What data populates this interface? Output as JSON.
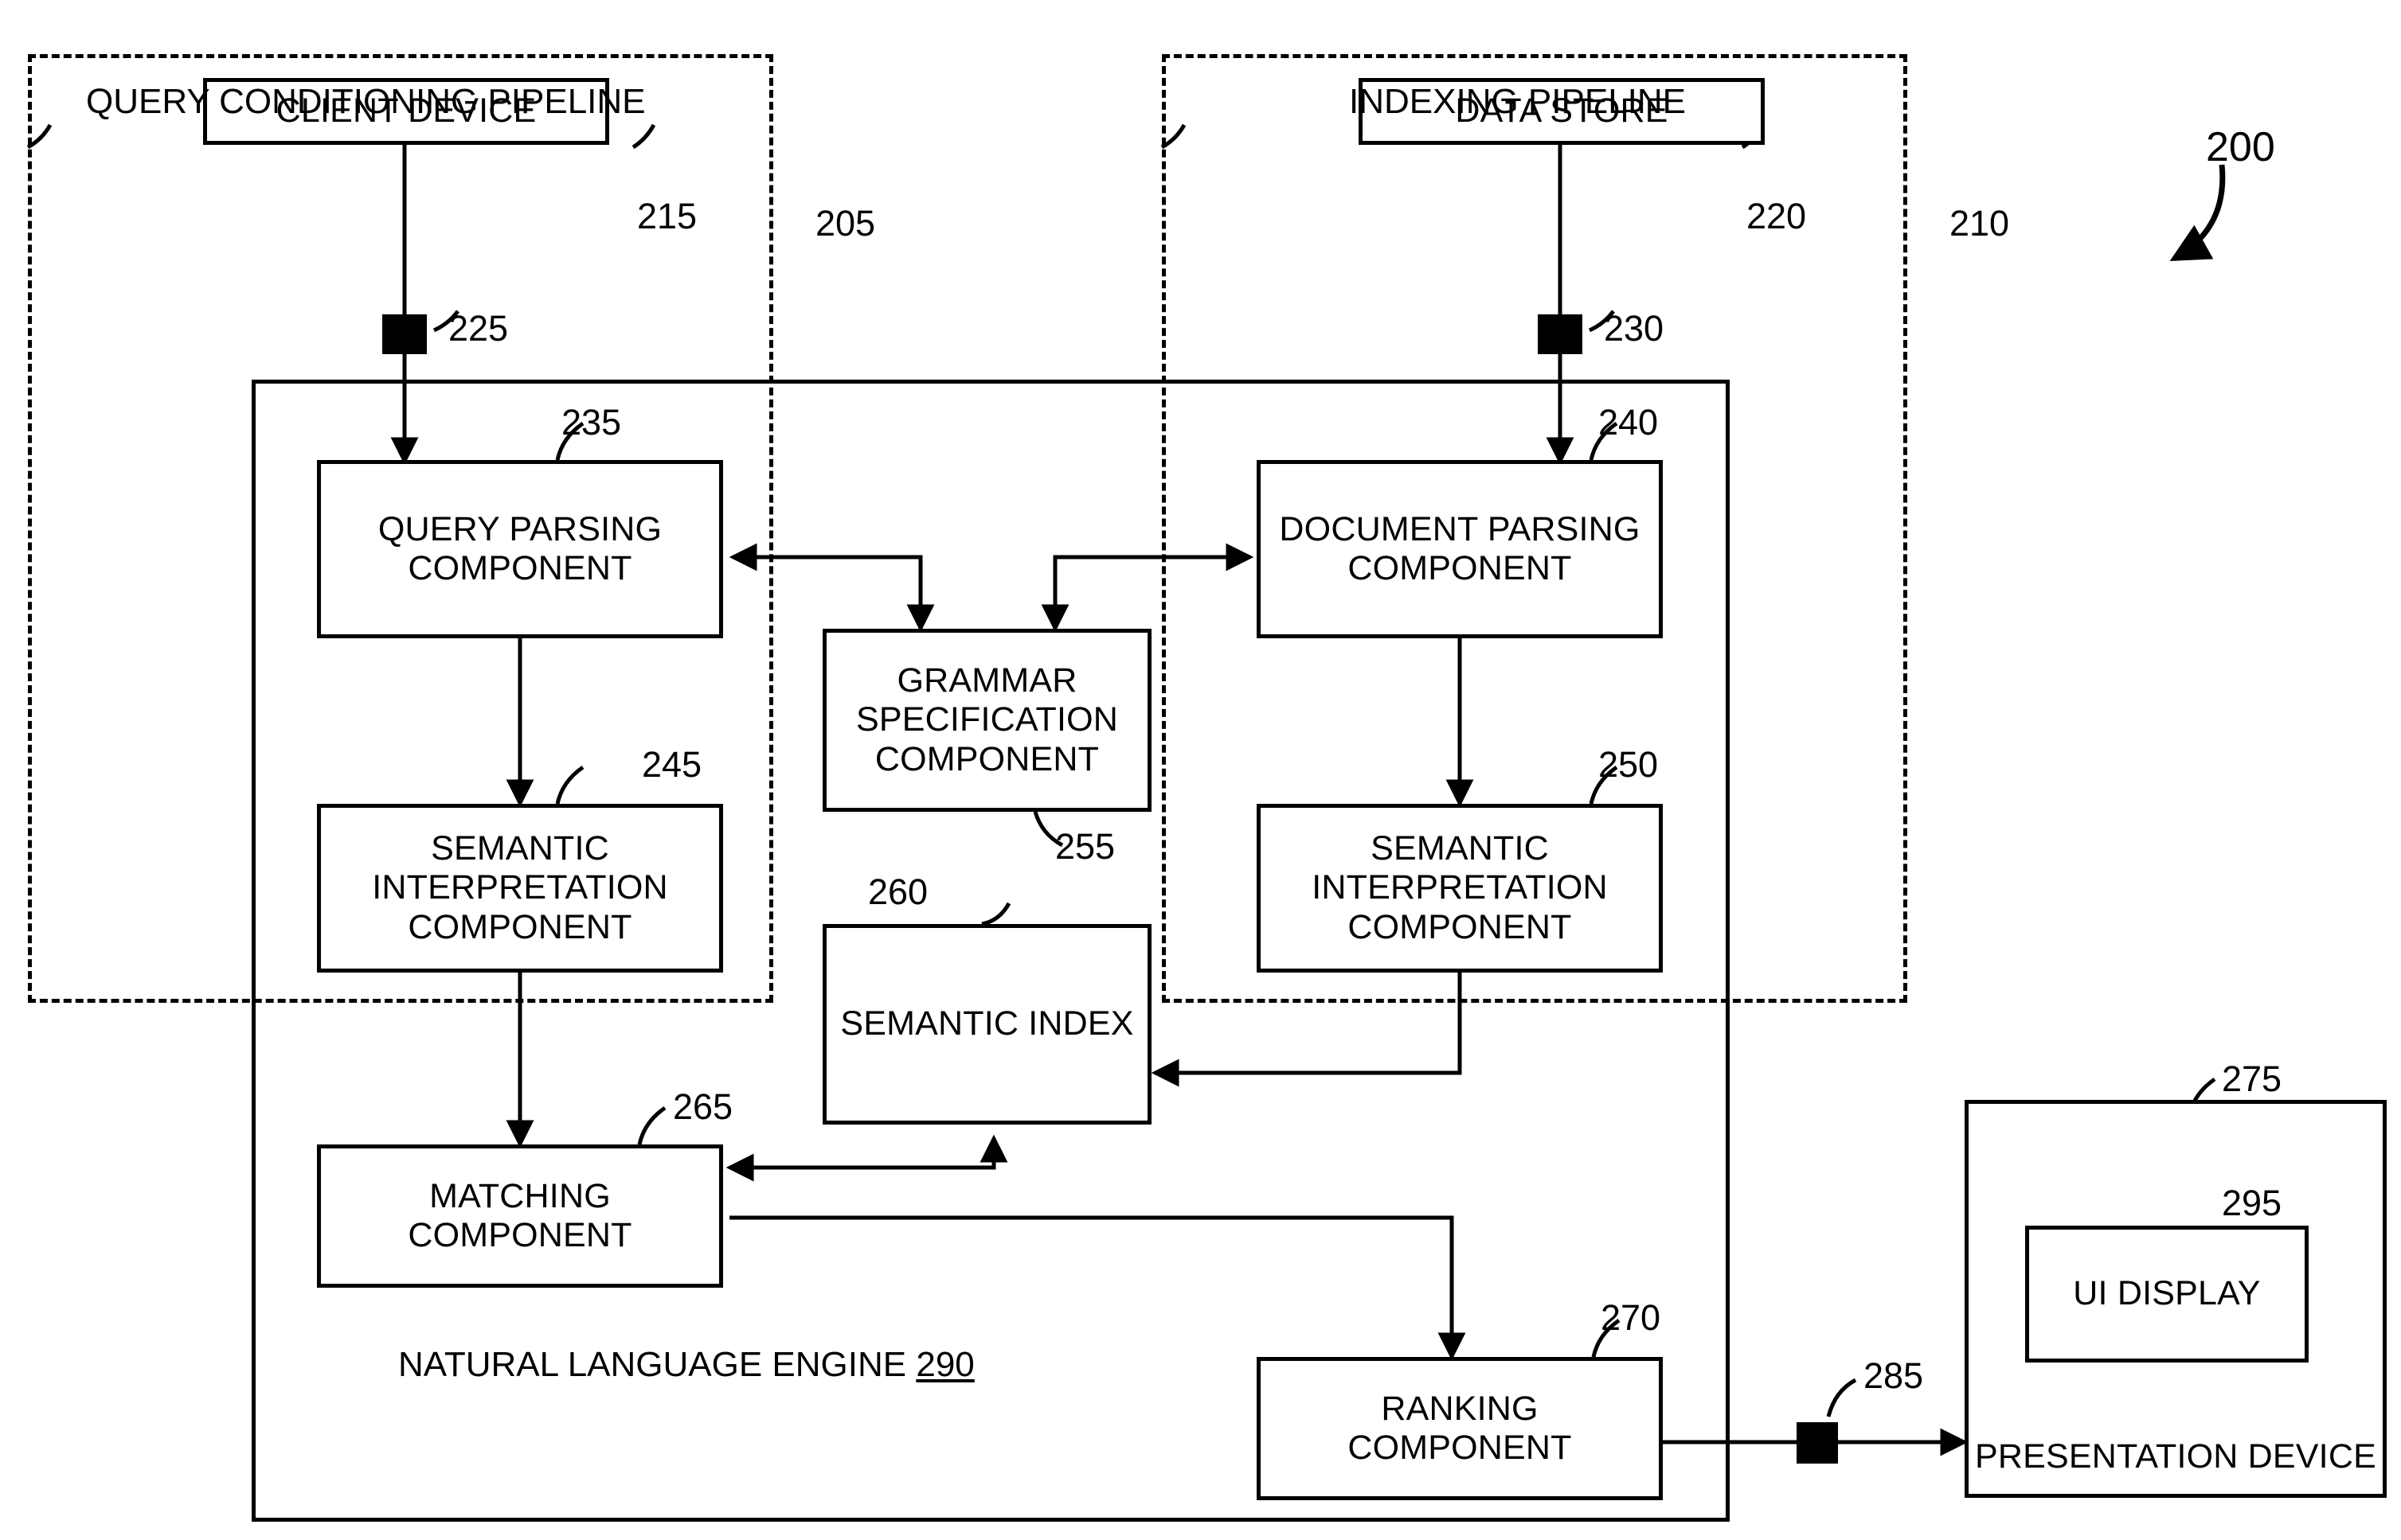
{
  "figure": {
    "number": "200",
    "title_label": "200"
  },
  "regions": {
    "query_pipeline": {
      "title": "QUERY CONDITIONING PIPELINE",
      "ref": "205"
    },
    "indexing_pipeline": {
      "title": "INDEXING PIPELINE",
      "ref": "210"
    },
    "natural_language_engine": {
      "label_prefix": "NATURAL LANGUAGE ENGINE ",
      "label_ref": "290"
    }
  },
  "boxes": {
    "client_device": {
      "label": "CLIENT DEVICE",
      "ref": "215"
    },
    "data_store": {
      "label": "DATA STORE",
      "ref": "220"
    },
    "query_parsing": {
      "label": "QUERY PARSING COMPONENT",
      "ref": "235"
    },
    "document_parsing": {
      "label": "DOCUMENT PARSING COMPONENT",
      "ref": "240"
    },
    "grammar_specification": {
      "label": "GRAMMAR SPECIFICATION COMPONENT",
      "ref": "255"
    },
    "semantic_interpretation_left": {
      "label": "SEMANTIC INTERPRETATION COMPONENT",
      "ref": "245"
    },
    "semantic_interpretation_right": {
      "label": "SEMANTIC INTERPRETATION COMPONENT",
      "ref": "250"
    },
    "semantic_index": {
      "label": "SEMANTIC INDEX",
      "ref": "260"
    },
    "matching": {
      "label": "MATCHING COMPONENT",
      "ref": "265"
    },
    "ranking": {
      "label": "RANKING COMPONENT",
      "ref": "270"
    },
    "presentation_device": {
      "label": "PRESENTATION DEVICE",
      "ref": "275"
    },
    "ui_display": {
      "label": "UI DISPLAY",
      "ref": "295"
    }
  },
  "connectors": {
    "query_link": {
      "ref": "225"
    },
    "index_link": {
      "ref": "230"
    },
    "output_link": {
      "ref": "285"
    }
  },
  "colors": {
    "line": "#000000",
    "background": "#ffffff"
  }
}
